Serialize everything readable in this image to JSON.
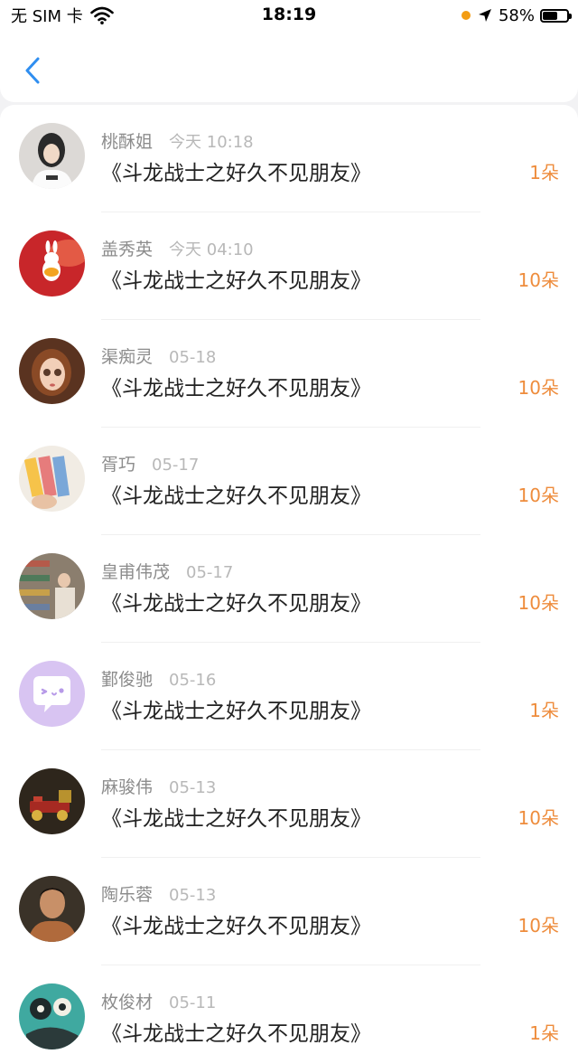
{
  "status_bar": {
    "carrier": "无 SIM 卡",
    "time": "18:19",
    "battery_percent_label": "58%",
    "battery_level": 0.58,
    "location_dot_color": "#f39c12"
  },
  "nav": {
    "back_icon": "chevron-left-icon",
    "accent_color": "#2f8ef0"
  },
  "items": [
    {
      "username": "桃酥姐",
      "time": "今天 10:18",
      "title": "《斗龙战士之好久不见朋友》",
      "amount": "1朵"
    },
    {
      "username": "盖秀英",
      "time": "今天 04:10",
      "title": "《斗龙战士之好久不见朋友》",
      "amount": "10朵"
    },
    {
      "username": "渠痴灵",
      "time": "05-18",
      "title": "《斗龙战士之好久不见朋友》",
      "amount": "10朵"
    },
    {
      "username": "胥巧",
      "time": "05-17",
      "title": "《斗龙战士之好久不见朋友》",
      "amount": "10朵"
    },
    {
      "username": "皇甫伟茂",
      "time": "05-17",
      "title": "《斗龙战士之好久不见朋友》",
      "amount": "10朵"
    },
    {
      "username": "鄞俊驰",
      "time": "05-16",
      "title": "《斗龙战士之好久不见朋友》",
      "amount": "1朵"
    },
    {
      "username": "麻骏伟",
      "time": "05-13",
      "title": "《斗龙战士之好久不见朋友》",
      "amount": "10朵"
    },
    {
      "username": "陶乐蓉",
      "time": "05-13",
      "title": "《斗龙战士之好久不见朋友》",
      "amount": "10朵"
    },
    {
      "username": "枚俊材",
      "time": "05-11",
      "title": "《斗龙战士之好久不见朋友》",
      "amount": "1朵"
    }
  ],
  "colors": {
    "amount": "#ee8c3c",
    "username": "#8c8c8c",
    "time": "#b8b8b8",
    "title": "#222222"
  }
}
